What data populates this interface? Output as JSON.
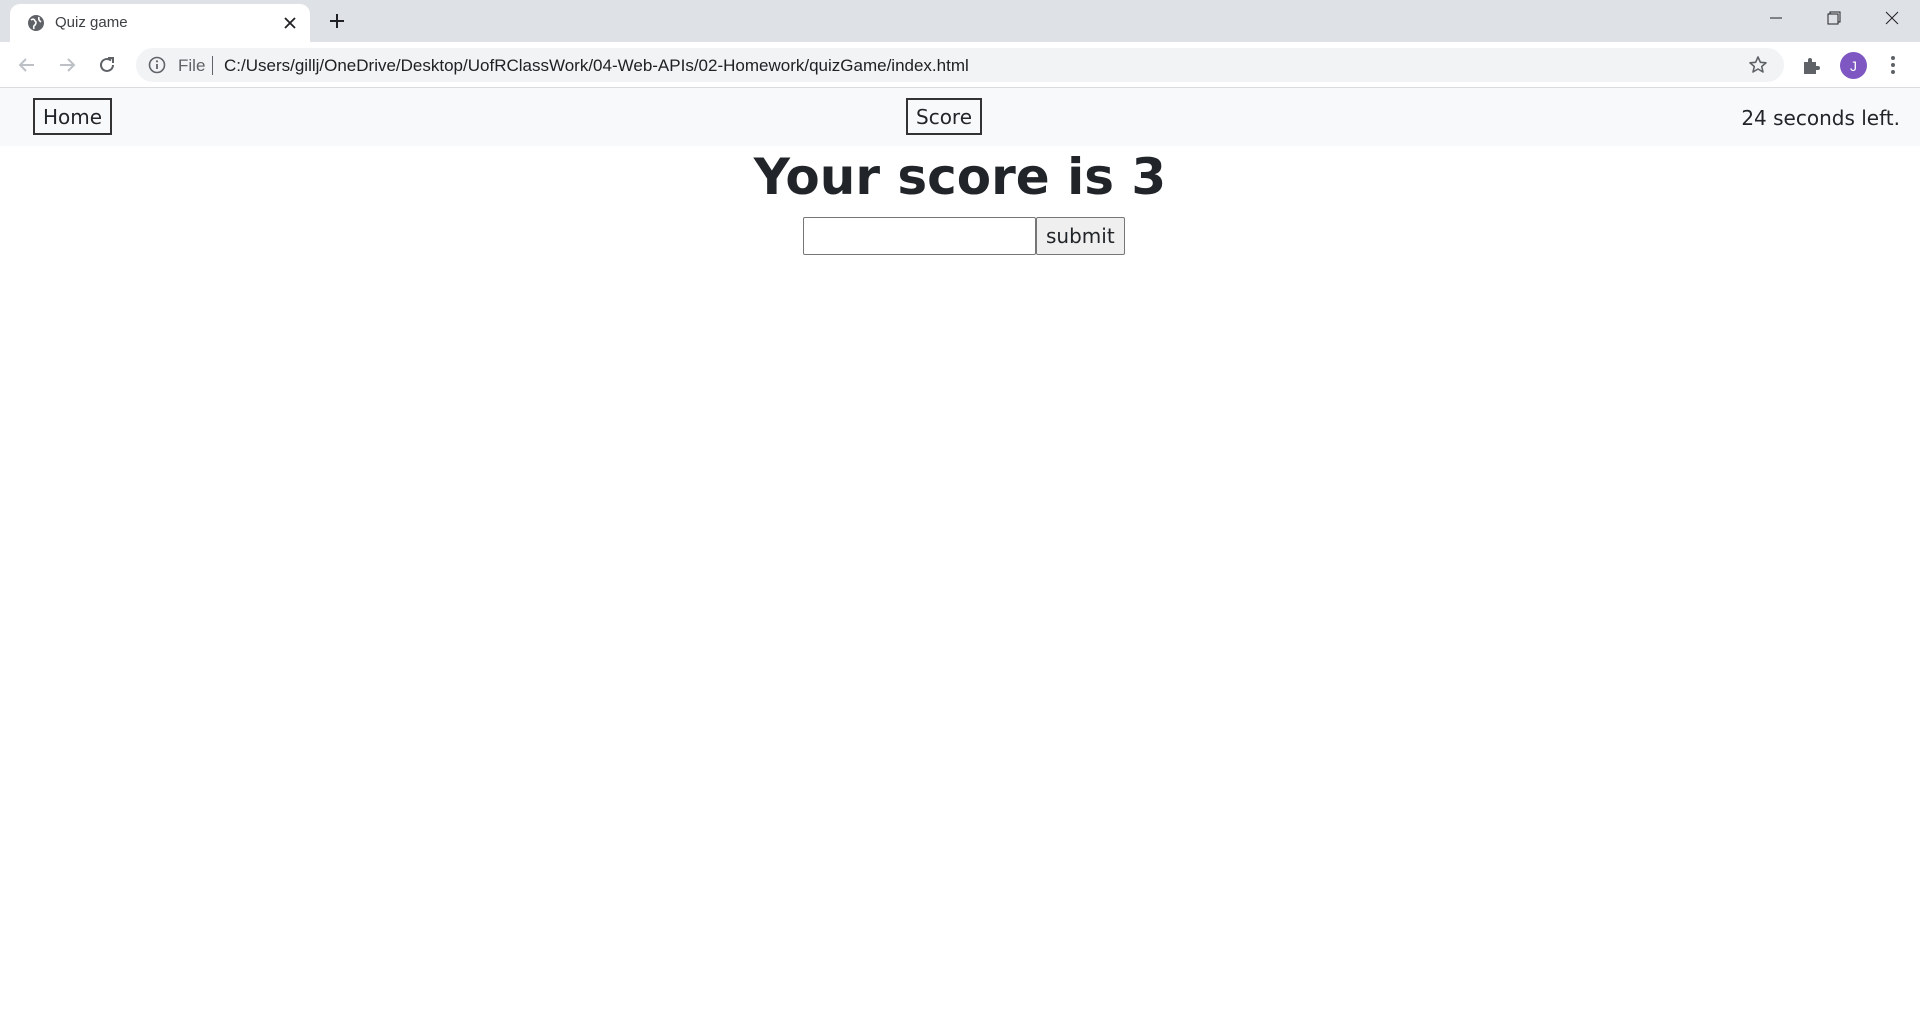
{
  "browser": {
    "tab_title": "Quiz game",
    "url_scheme_label": "File",
    "url": "C:/Users/gillj/OneDrive/Desktop/UofRClassWork/04-Web-APIs/02-Homework/quizGame/index.html",
    "profile_initial": "J",
    "profile_color": "#7e57c2"
  },
  "page": {
    "nav": {
      "home_label": "Home",
      "score_label": "Score",
      "timer_text": "24 seconds left."
    },
    "score_heading": "Your score is 3",
    "initials_input": {
      "value": "",
      "placeholder": ""
    },
    "submit_label": "submit"
  }
}
